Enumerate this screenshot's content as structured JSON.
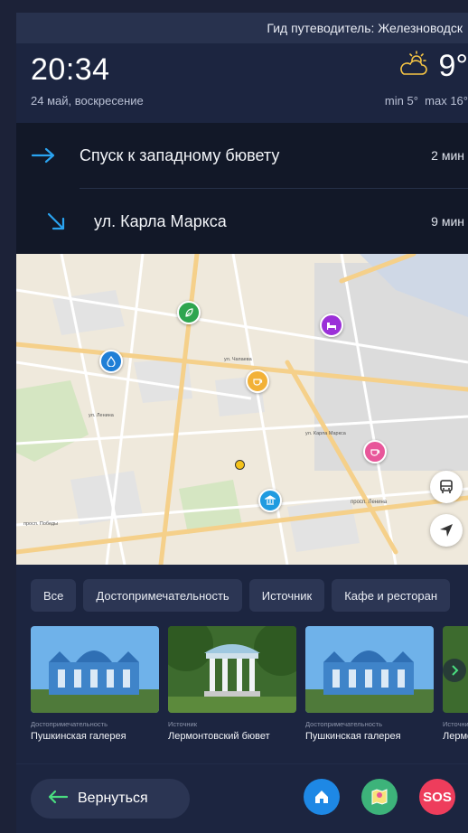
{
  "header": {
    "title": "Гид путеводитель: Железноводск"
  },
  "clock": {
    "time": "20:34",
    "date": "24 май, воскресение"
  },
  "weather": {
    "icon": "partly-cloudy-icon",
    "temp": "9°",
    "min": "min 5°",
    "max": "max 16°"
  },
  "routes": [
    {
      "direction_icon": "arrow-right-icon",
      "name": "Спуск к западному бювету",
      "time": "2 мин"
    },
    {
      "direction_icon": "arrow-down-right-icon",
      "name": "ул. Карла Маркса",
      "time": "9 мин"
    }
  ],
  "map": {
    "street_labels": [
      "ул. Чапаева",
      "ул. Ленина",
      "просп. Ленина",
      "ул. Карла Маркса",
      "просп. Победы"
    ],
    "markers": [
      {
        "type": "park",
        "color": "#2ea54f"
      },
      {
        "type": "source",
        "color": "#1f7fd6"
      },
      {
        "type": "hotel",
        "color": "#9b30d8"
      },
      {
        "type": "cafe",
        "color": "#f2b137"
      },
      {
        "type": "cafe",
        "color": "#e8569a"
      },
      {
        "type": "museum",
        "color": "#1f9be0"
      }
    ],
    "buttons": {
      "transport": "bus-icon",
      "locate": "navigation-arrow-icon"
    }
  },
  "filters": [
    "Все",
    "Достопримечательность",
    "Источник",
    "Кафе и ресторан"
  ],
  "cards": [
    {
      "category": "Достопримечательность",
      "name": "Пушкинская галерея"
    },
    {
      "category": "Источник",
      "name": "Лермонтовский бювет"
    },
    {
      "category": "Достопримечательность",
      "name": "Пушкинская галерея"
    },
    {
      "category": "Источник",
      "name": "Лермонтовский бювет"
    }
  ],
  "bottom": {
    "back_label": "Вернуться",
    "home_color": "#1e88e5",
    "map_color": "#3db37a",
    "sos_label": "SOS",
    "sos_color": "#ee3d5c"
  },
  "colors": {
    "accent": "#2aa3f0",
    "background": "#1c2540",
    "panel": "#2c3654"
  }
}
